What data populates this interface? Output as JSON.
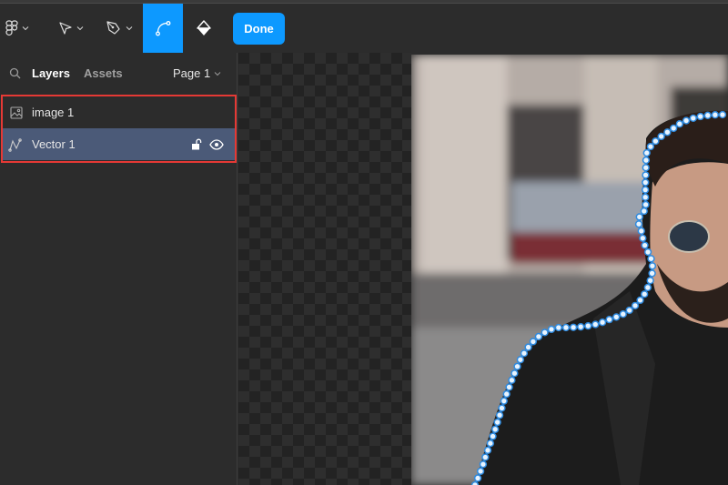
{
  "toolbar": {
    "tools": [
      {
        "name": "main-menu",
        "icon": "figma-logo-icon",
        "has_dropdown": true
      },
      {
        "name": "move-tool",
        "icon": "cursor-arrow-icon",
        "has_dropdown": true
      },
      {
        "name": "pen-tool",
        "icon": "pen-nib-icon",
        "has_dropdown": true
      },
      {
        "name": "bend-tool",
        "icon": "bend-curve-icon",
        "active": true
      },
      {
        "name": "paint-bucket-tool",
        "icon": "paint-bucket-icon"
      }
    ],
    "done_label": "Done",
    "accent_color": "#0d99ff"
  },
  "left_panel": {
    "tabs": [
      {
        "label": "Layers",
        "active": true
      },
      {
        "label": "Assets",
        "active": false
      }
    ],
    "page_selector": "Page 1",
    "layers": [
      {
        "name": "image 1",
        "icon": "image-icon",
        "selected": false
      },
      {
        "name": "Vector 1",
        "icon": "vector-path-icon",
        "selected": true,
        "lock_state": "unlocked",
        "visible": true
      }
    ],
    "highlight_color": "#e53935"
  }
}
